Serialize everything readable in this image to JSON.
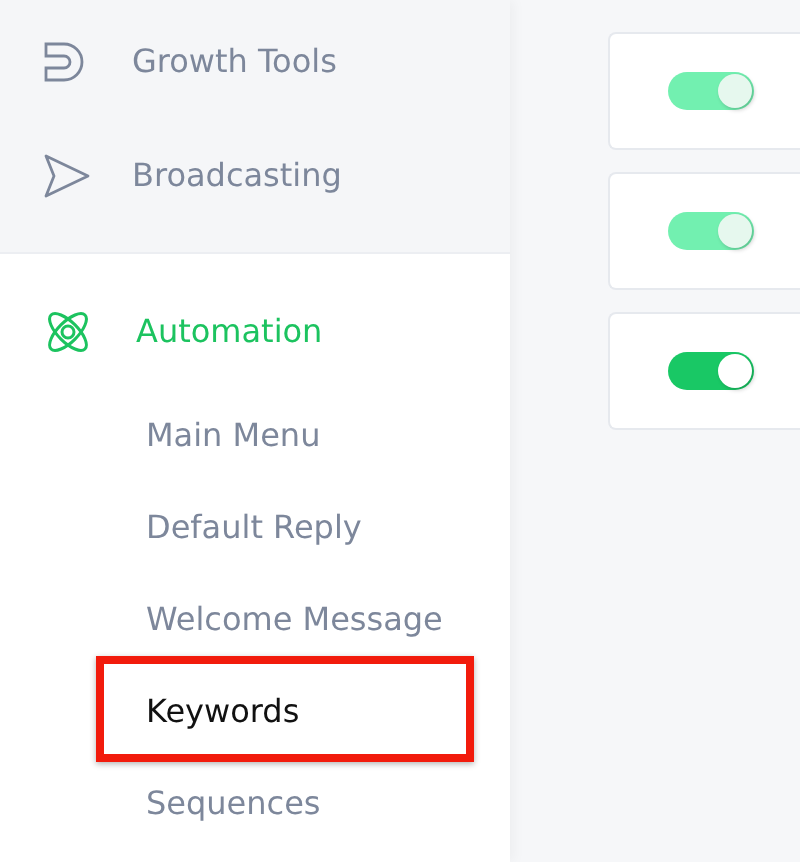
{
  "sidebar": {
    "top_items": [
      {
        "kind": "magnet",
        "label": "Growth Tools",
        "selected": false
      },
      {
        "kind": "send",
        "label": "Broadcasting",
        "selected": false
      }
    ],
    "section": {
      "kind": "atom",
      "label": "Automation",
      "selected": true,
      "children": [
        {
          "label": "Main Menu",
          "highlighted": false
        },
        {
          "label": "Default Reply",
          "highlighted": false
        },
        {
          "label": "Welcome Message",
          "highlighted": false
        },
        {
          "label": "Keywords",
          "highlighted": true
        },
        {
          "label": "Sequences",
          "highlighted": false
        }
      ]
    }
  },
  "cards": [
    {
      "on": true,
      "disabled": true
    },
    {
      "on": true,
      "disabled": true
    },
    {
      "on": true,
      "disabled": false
    }
  ]
}
